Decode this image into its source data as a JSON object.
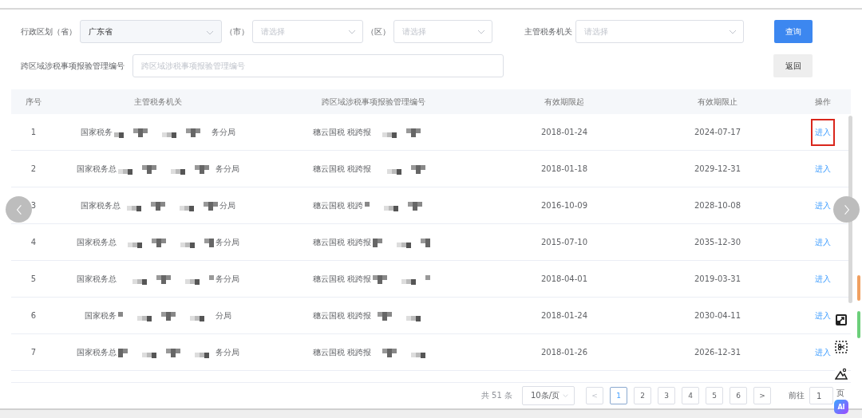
{
  "filters": {
    "province": {
      "label": "行政区划（省）",
      "value": "广东省"
    },
    "city": {
      "label": "（市）",
      "placeholder": "请选择"
    },
    "district": {
      "label": "（区）",
      "placeholder": "请选择"
    },
    "authority": {
      "label": "主管税务机关",
      "placeholder": "请选择"
    },
    "number": {
      "label": "跨区域涉税事项报验管理编号",
      "placeholder": "跨区域涉税事项报验管理编号"
    },
    "buttons": [
      {
        "label": "查询",
        "kind": "primary"
      },
      {
        "label": "返回",
        "kind": "default"
      }
    ]
  },
  "table": {
    "columns": [
      "序号",
      "主管税务机关",
      "跨区域涉税事项报验管理编号",
      "有效期限起",
      "有效期限止",
      "操作"
    ],
    "rows": [
      {
        "index": "1",
        "agency_start": "国家税务",
        "agency_end": "务分局",
        "number_start": "穗云国税 税跨报",
        "valid_from": "2018-01-24",
        "valid_to": "2024-07-17",
        "action": "进入",
        "highlighted": true
      },
      {
        "index": "2",
        "agency_start": "国家税务总",
        "agency_end": "务分局",
        "number_start": "穗云国税 税跨报",
        "valid_from": "2018-01-18",
        "valid_to": "2029-12-31",
        "action": "进入",
        "highlighted": false
      },
      {
        "index": "3",
        "agency_start": "国家税务总",
        "agency_end": "分局",
        "number_start": "穗云国税 税跨",
        "valid_from": "2016-10-09",
        "valid_to": "2028-10-08",
        "action": "进入",
        "highlighted": false
      },
      {
        "index": "4",
        "agency_start": "国家税务总",
        "agency_end": "务分局",
        "number_start": "穗云国税 税跨报",
        "valid_from": "2015-07-10",
        "valid_to": "2035-12-30",
        "action": "进入",
        "highlighted": false
      },
      {
        "index": "5",
        "agency_start": "国家税务总",
        "agency_end": "务分局",
        "number_start": "穗云国税 税跨报",
        "valid_from": "2018-04-01",
        "valid_to": "2019-03-31",
        "action": "进入",
        "highlighted": false
      },
      {
        "index": "6",
        "agency_start": "国家税务",
        "agency_end": "分局",
        "number_start": "穗云国税 税跨报",
        "valid_from": "2018-01-24",
        "valid_to": "2030-04-11",
        "action": "进入",
        "highlighted": false
      },
      {
        "index": "7",
        "agency_start": "国家税务总",
        "agency_end": "务分局",
        "number_start": "穗云国税 税跨报",
        "valid_from": "2018-01-26",
        "valid_to": "2026-12-31",
        "action": "进入",
        "highlighted": false
      }
    ]
  },
  "pagination": {
    "total": "共 51 条",
    "page_size": "10条/页",
    "prev": "<",
    "pages": [
      {
        "label": "1",
        "selected": true
      },
      {
        "label": "2",
        "selected": false
      },
      {
        "label": "3",
        "selected": false
      },
      {
        "label": "4",
        "selected": false
      },
      {
        "label": "5",
        "selected": false
      },
      {
        "label": "6",
        "selected": false
      }
    ],
    "next": ">",
    "goto_label": "前往",
    "goto_value": "1",
    "goto_suffix": "页"
  },
  "side_tools": [
    {
      "kind": "expand"
    },
    {
      "kind": "capture"
    },
    {
      "kind": "image"
    },
    {
      "kind": "ai",
      "label": "AI"
    }
  ]
}
